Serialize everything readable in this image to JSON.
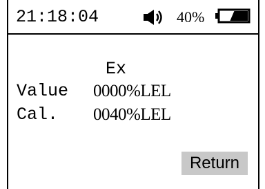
{
  "status_bar": {
    "time": "21:18:04",
    "sound_icon": "speaker-volume-icon",
    "battery_percent": "40%",
    "battery_icon": "battery-icon",
    "battery_level": 0.4
  },
  "main": {
    "gas_name": "Ex",
    "rows": [
      {
        "label": "Value",
        "value": "0000%LEL"
      },
      {
        "label": "Cal.",
        "value": "0040%LEL"
      }
    ]
  },
  "actions": {
    "return_label": "Return"
  },
  "colors": {
    "foreground": "#000000",
    "background": "#ffffff",
    "button_highlight": "#c8c8c8"
  }
}
